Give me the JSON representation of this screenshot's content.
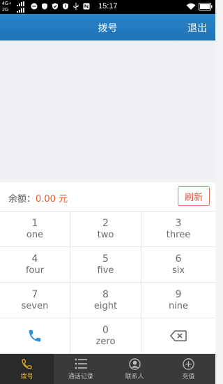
{
  "status_bar": {
    "network_top": "4G+",
    "network_bottom": "2G",
    "time": "15:17"
  },
  "header": {
    "title": "拨号",
    "exit_label": "退出"
  },
  "balance": {
    "label": "余额：",
    "value": "0.00",
    "unit": " 元",
    "refresh_label": "刷新"
  },
  "keypad": {
    "keys": [
      {
        "num": "1",
        "sub": "one"
      },
      {
        "num": "2",
        "sub": "two"
      },
      {
        "num": "3",
        "sub": "three"
      },
      {
        "num": "4",
        "sub": "four"
      },
      {
        "num": "5",
        "sub": "five"
      },
      {
        "num": "6",
        "sub": "six"
      },
      {
        "num": "7",
        "sub": "seven"
      },
      {
        "num": "8",
        "sub": "eight"
      },
      {
        "num": "9",
        "sub": "nine"
      },
      {
        "num": "0",
        "sub": "zero"
      }
    ],
    "call_icon": "phone-icon",
    "delete_icon": "backspace-icon"
  },
  "bottom_nav": {
    "items": [
      {
        "label": "拨号",
        "icon": "phone-icon",
        "active": true
      },
      {
        "label": "通话记录",
        "icon": "list-icon"
      },
      {
        "label": "联系人",
        "icon": "contact-icon"
      },
      {
        "label": "充值",
        "icon": "plus-circle-icon"
      }
    ]
  },
  "colors": {
    "header": "#2a85c9",
    "accent": "#f15a22",
    "nav_active": "#f0b323",
    "call": "#2a8fd8"
  }
}
